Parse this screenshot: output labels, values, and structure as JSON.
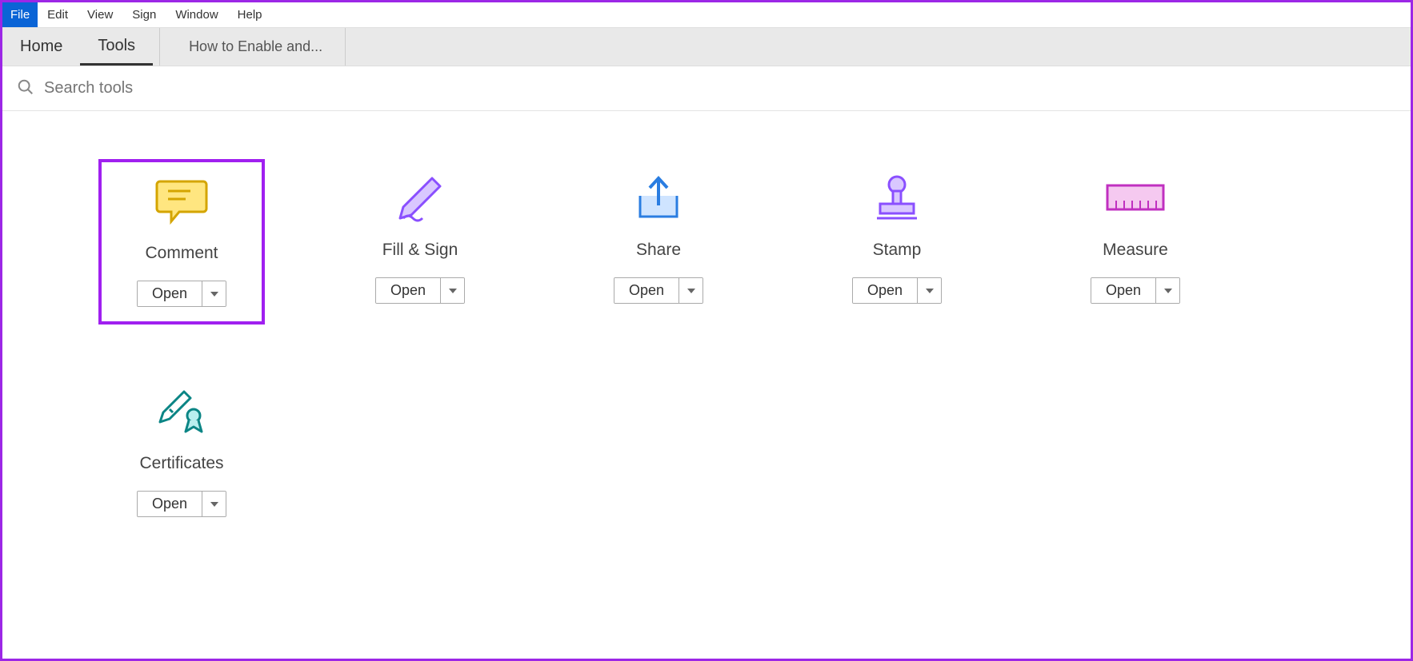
{
  "menubar": {
    "items": [
      "File",
      "Edit",
      "View",
      "Sign",
      "Window",
      "Help"
    ]
  },
  "tabbar": {
    "home": "Home",
    "tools": "Tools",
    "doc_tab": "How to Enable and..."
  },
  "search": {
    "placeholder": "Search tools"
  },
  "tools": [
    {
      "label": "Comment",
      "action": "Open",
      "icon": "comment-icon",
      "highlight": true
    },
    {
      "label": "Fill & Sign",
      "action": "Open",
      "icon": "pen-icon",
      "highlight": false
    },
    {
      "label": "Share",
      "action": "Open",
      "icon": "share-icon",
      "highlight": false
    },
    {
      "label": "Stamp",
      "action": "Open",
      "icon": "stamp-icon",
      "highlight": false
    },
    {
      "label": "Measure",
      "action": "Open",
      "icon": "ruler-icon",
      "highlight": false
    },
    {
      "label": "Certificates",
      "action": "Open",
      "icon": "certificate-icon",
      "highlight": false
    }
  ]
}
